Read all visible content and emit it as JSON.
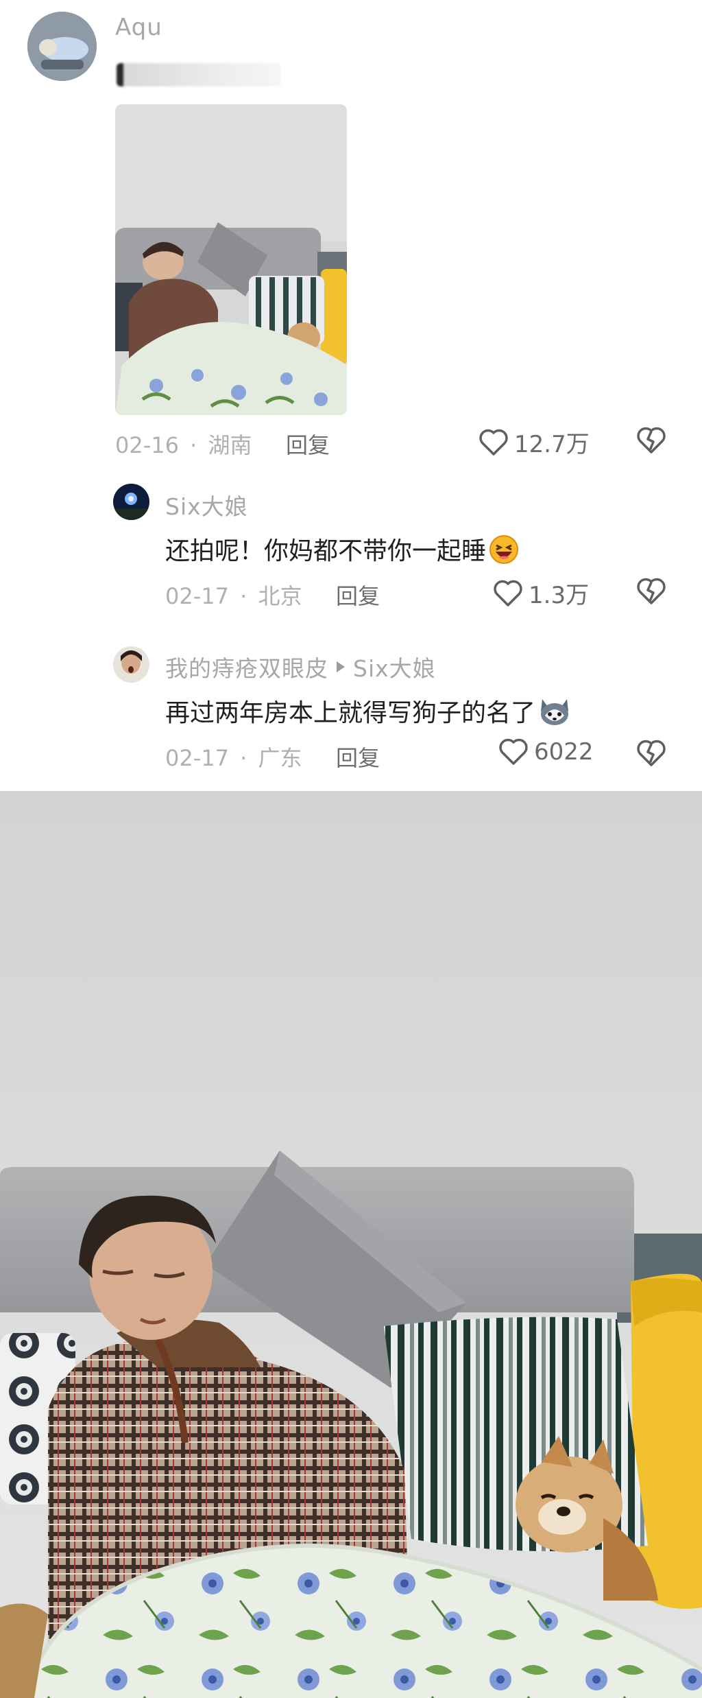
{
  "comment": {
    "username": "Aqu",
    "date": "02-16",
    "location": "湖南",
    "reply_label": "回复",
    "likes": "12.7万"
  },
  "replies": [
    {
      "username": "Six大娘",
      "text": "还拍呢！你妈都不带你一起睡",
      "date": "02-17",
      "location": "北京",
      "reply_label": "回复",
      "likes": "1.3万"
    },
    {
      "username": "我的痔疮双眼皮",
      "reply_to": "Six大娘",
      "text": "再过两年房本上就得写狗子的名了",
      "date": "02-17",
      "location": "广东",
      "reply_label": "回复",
      "likes": "6022"
    }
  ],
  "separator": "·",
  "icons": [
    "heart-icon",
    "broken-heart-icon",
    "laughing-emoji-icon",
    "husky-emoji-icon",
    "reply-arrow-icon"
  ],
  "colors": {
    "username": "#a7a7a7",
    "meta": "#b0b0b0",
    "text": "#1f1f1f",
    "wall": "#dcdcdc",
    "sofa": "#a9abad",
    "yellow_pillow": "#f2c12e"
  }
}
